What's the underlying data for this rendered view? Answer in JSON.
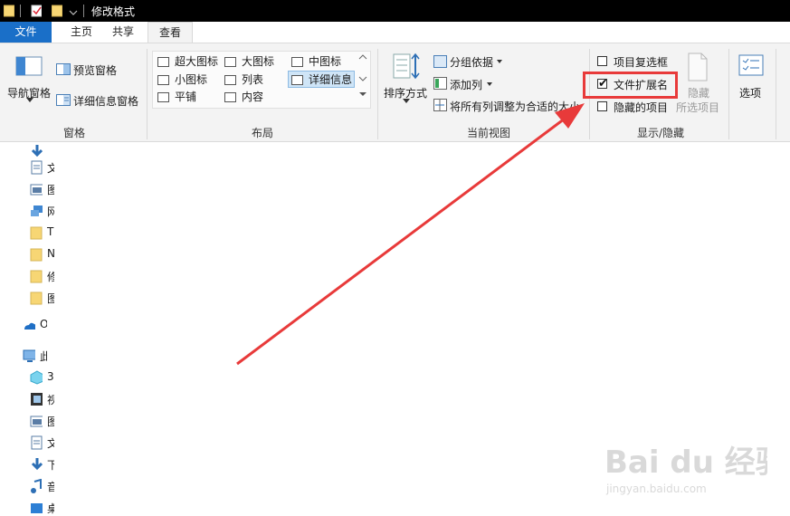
{
  "window": {
    "title": "修改格式"
  },
  "tabs": [
    {
      "label": "文件"
    },
    {
      "label": "主页"
    },
    {
      "label": "共享"
    },
    {
      "label": "查看"
    }
  ],
  "ribbon": {
    "panes": {
      "nav_pane": "导航窗格",
      "preview_pane": "预览窗格",
      "details_pane": "详细信息窗格",
      "group_label": "窗格"
    },
    "layout": {
      "items": [
        {
          "label": "超大图标"
        },
        {
          "label": "大图标"
        },
        {
          "label": "中图标"
        },
        {
          "label": "小图标"
        },
        {
          "label": "列表"
        },
        {
          "label": "详细信息"
        },
        {
          "label": "平铺"
        },
        {
          "label": "内容"
        }
      ],
      "group_label": "布局"
    },
    "current_view": {
      "sort_by": "排序方式",
      "group_by": "分组依据",
      "add_columns": "添加列",
      "fit_columns": "将所有列调整为合适的大小",
      "group_label": "当前视图"
    },
    "show_hide": {
      "item_checkboxes": "项目复选框",
      "file_extensions": "文件扩展名",
      "hidden_items": "隐藏的项目",
      "hide_selected_1": "隐藏",
      "hide_selected_2": "所选项目",
      "group_label": "显示/隐藏",
      "file_extensions_checked": true,
      "item_checkboxes_checked": false,
      "hidden_items_checked": false
    },
    "options": {
      "label": "选项"
    }
  },
  "nav": {
    "items": [
      {
        "icon": "download-arrow-icon",
        "text": ""
      },
      {
        "icon": "document-icon",
        "text": "文"
      },
      {
        "icon": "picture-icon",
        "text": "图"
      },
      {
        "icon": "network-icon",
        "text": "网"
      },
      {
        "icon": "folder-icon",
        "text": "T"
      },
      {
        "icon": "folder-icon",
        "text": "N"
      },
      {
        "icon": "folder-icon",
        "text": "修"
      },
      {
        "icon": "folder-icon",
        "text": "图"
      },
      {
        "icon": "onedrive-icon",
        "text": "O"
      },
      {
        "icon": "this-pc-icon",
        "text": "此"
      },
      {
        "icon": "3d-objects-icon",
        "text": "3"
      },
      {
        "icon": "video-icon",
        "text": "视"
      },
      {
        "icon": "picture-icon",
        "text": "图"
      },
      {
        "icon": "document-icon",
        "text": "文"
      },
      {
        "icon": "download-arrow-icon",
        "text": "下"
      },
      {
        "icon": "music-icon",
        "text": "音"
      },
      {
        "icon": "desktop-icon",
        "text": "桌"
      }
    ]
  },
  "watermark": {
    "brand": "Bai du 经验",
    "url": "jingyan.baidu.com"
  },
  "colors": {
    "file_tab": "#1a6fc8",
    "annotation_red": "#e83a3a",
    "folder_yellow": "#f7d674"
  }
}
